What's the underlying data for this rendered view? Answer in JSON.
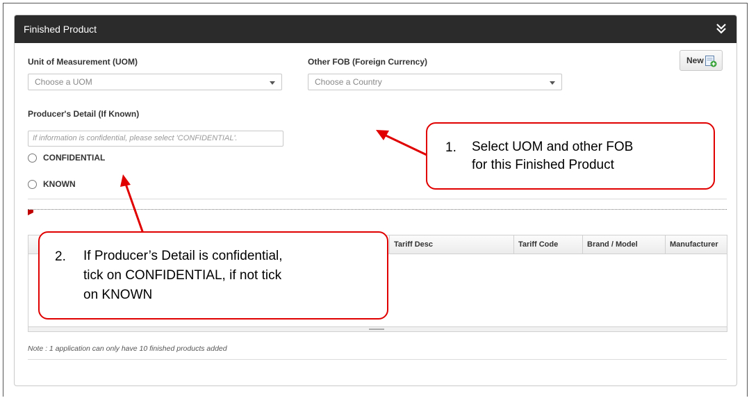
{
  "panel": {
    "title": "Finished Product",
    "collapse_icon": "double-chevron-down-icon"
  },
  "form": {
    "uom_label": "Unit of Measurement (UOM)",
    "uom_placeholder": "Choose a UOM",
    "fob_label": "Other FOB (Foreign Currency)",
    "fob_placeholder": "Choose a Country",
    "new_button_label": "New",
    "producer_label": "Producer's Detail (If Known)",
    "producer_placeholder": "If information is confidential, please select 'CONFIDENTIAL'.",
    "radio_confidential": "CONFIDENTIAL",
    "radio_known": "KNOWN"
  },
  "table": {
    "columns": [
      "Tariff Desc",
      "Tariff Code",
      "Brand / Model",
      "Manufacturer"
    ]
  },
  "note": "Note : 1 application can only have 10 finished products added",
  "callouts": [
    {
      "number": "1.",
      "lines": [
        "Select UOM and other FOB",
        "for this Finished Product"
      ]
    },
    {
      "number": "2.",
      "lines": [
        "If Producer’s Detail is confidential,",
        "tick on CONFIDENTIAL, if not tick",
        "on KNOWN"
      ]
    }
  ],
  "colors": {
    "header_bg": "#2b2b2b",
    "callout_border": "#e00000",
    "arrow": "#e00000"
  }
}
